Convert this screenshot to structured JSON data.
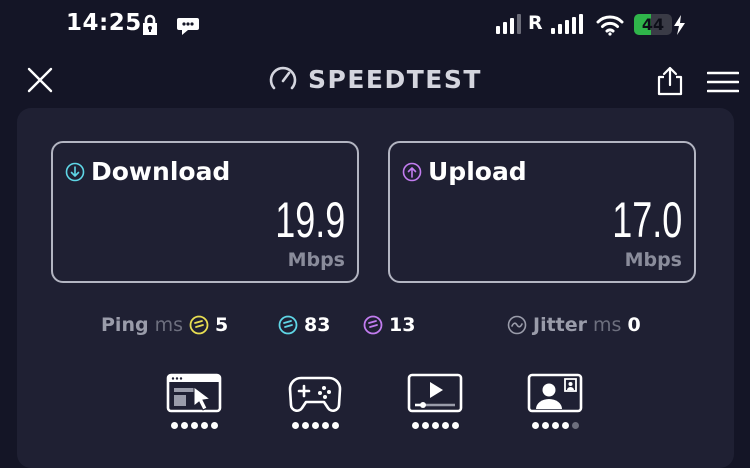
{
  "status_bar": {
    "time": "14:25",
    "roaming_label": "R",
    "battery_level": "44",
    "battery_fraction": 0.44,
    "battery_color": "#2fb54a",
    "icons": [
      "lock-icon",
      "chat-bubble-icon",
      "signal-icon",
      "wifi-icon",
      "battery-icon",
      "charging-bolt-icon"
    ]
  },
  "header": {
    "title": "SPEEDTEST",
    "icons": [
      "close-icon",
      "gauge-icon",
      "share-icon",
      "menu-icon"
    ]
  },
  "results": {
    "download": {
      "label": "Download",
      "value": "19.9",
      "unit": "Mbps",
      "accent": "#5fd6e6"
    },
    "upload": {
      "label": "Upload",
      "value": "17.0",
      "unit": "Mbps",
      "accent": "#c27cf0"
    }
  },
  "latency": {
    "ping_label": "Ping",
    "ping_unit": "ms",
    "idle": {
      "value": "5",
      "color": "#e8de52"
    },
    "download": {
      "value": "83",
      "color": "#5fd6e6"
    },
    "upload": {
      "value": "13",
      "color": "#c27cf0"
    },
    "jitter_label": "Jitter",
    "jitter_unit": "ms",
    "jitter_value": "0"
  },
  "experiences": [
    {
      "icon": "web-browsing-icon",
      "rating": 5,
      "max": 5
    },
    {
      "icon": "gaming-controller-icon",
      "rating": 5,
      "max": 5
    },
    {
      "icon": "video-streaming-icon",
      "rating": 5,
      "max": 5
    },
    {
      "icon": "video-call-icon",
      "rating": 4,
      "max": 5
    }
  ]
}
